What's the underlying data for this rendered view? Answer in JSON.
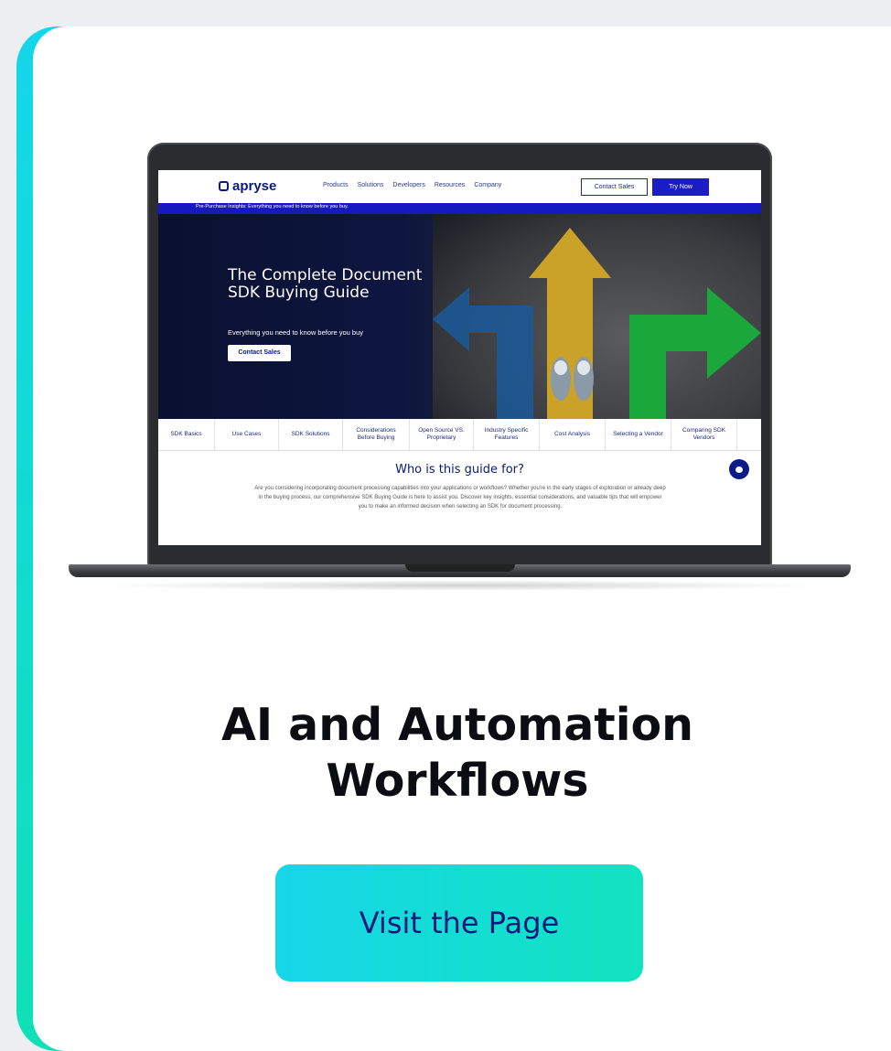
{
  "site": {
    "logo_text": "apryse",
    "nav": [
      "Products",
      "Solutions",
      "Developers",
      "Resources",
      "Company"
    ],
    "contact_sales_label": "Contact Sales",
    "try_now_label": "Try Now",
    "banner_text": "Pre-Purchase Insights: Everything you need to know before you buy."
  },
  "hero": {
    "title": "The Complete Document SDK Buying Guide",
    "subtitle": "Everything you need to know before you buy",
    "button_label": "Contact Sales"
  },
  "tabs": [
    "SDK Basics",
    "Use Cases",
    "SDK Solutions",
    "Considerations Before Buying",
    "Open Source VS. Proprietary",
    "Industry Specific Features",
    "Cost Analysis",
    "Selecting a Vendor",
    "Comparing SDK Vendors"
  ],
  "section": {
    "title": "Who is this guide for?",
    "body": "Are you considering incorporating document processing capabilities into your applications or workflows? Whether you're in the early stages of exploration or already deep in the buying process, our comprehensive SDK Buying Guide is here to assist you. Discover key insights, essential considerations, and valuable tips that will empower you to make an informed decision when selecting an SDK for document processing."
  },
  "card": {
    "title": "AI and Automation Workflows",
    "cta_label": "Visit the Page"
  },
  "colors": {
    "accent_start": "#14d6ea",
    "accent_end": "#10e0b6",
    "brand_navy": "#0a1a7a",
    "brand_blue": "#1a1cc4"
  }
}
